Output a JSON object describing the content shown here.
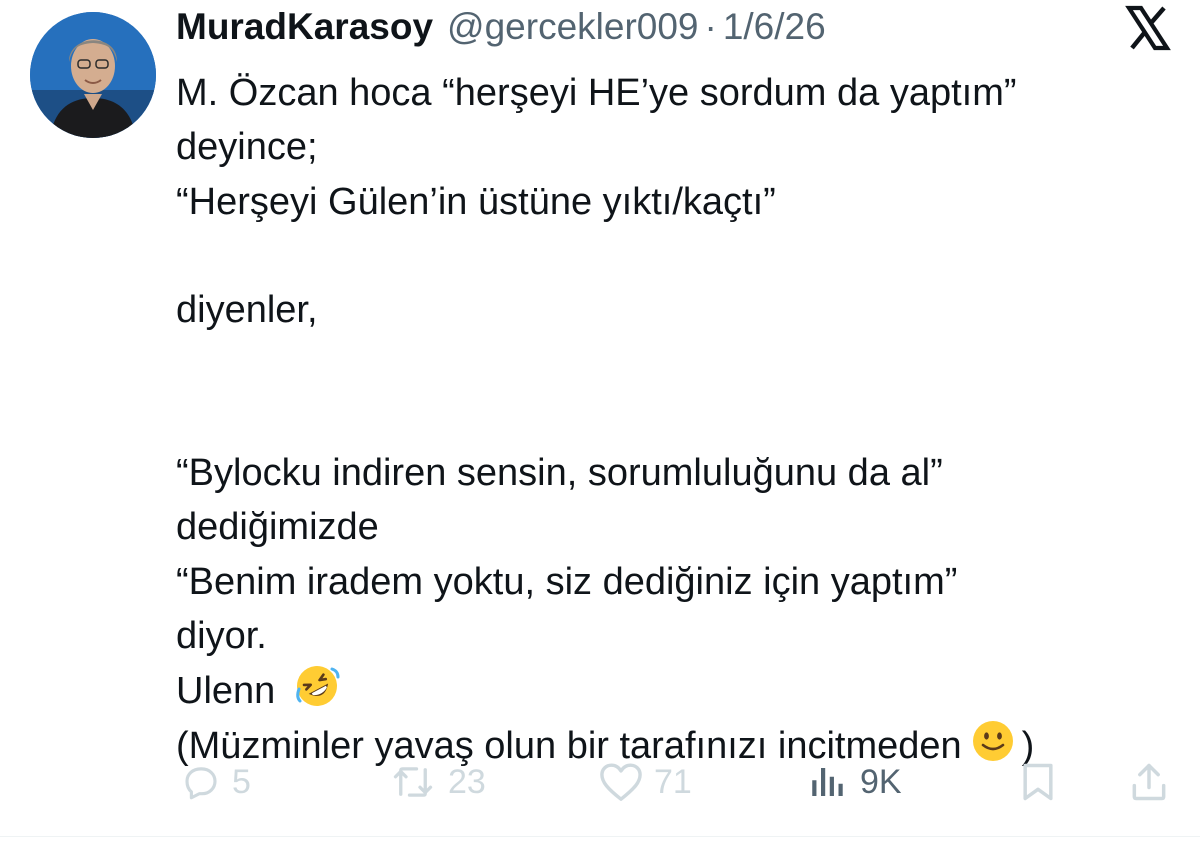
{
  "author": {
    "display_name": "MuradKarasoy",
    "handle": "@gercekler009",
    "separator": "·",
    "date": "1/6/26",
    "avatar_icon": "avatar-photo"
  },
  "platform_logo": "x-logo-icon",
  "tweet": {
    "lines": [
      "M. Özcan hoca “herşeyi HE’ye sordum da yaptım”",
      "deyince;",
      "“Herşeyi Gülen’in üstüne yıktı/kaçtı”",
      "",
      "diyenler,",
      "",
      "",
      "“Bylocku indiren sensin, sorumluluğunu da al”",
      "dediğimizde",
      "“Benim iradem yoktu, siz dediğiniz için yaptım”",
      "diyor.",
      "Ulenn",
      "(Müzminler yavaş olun bir tarafınızı incitmeden",
      ")"
    ]
  },
  "actions": {
    "replies": "5",
    "reposts": "23",
    "likes": "71",
    "views": "9K"
  },
  "colors": {
    "text": "#0f1419",
    "muted": "#536471",
    "faded": "#cfd9de",
    "emoji": "#ffcc33"
  }
}
